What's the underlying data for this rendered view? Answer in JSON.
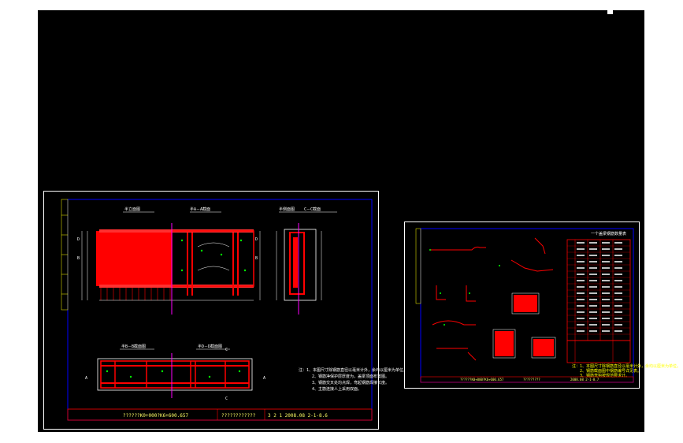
{
  "sheet1": {
    "views": {
      "elevation_title": "半立面图",
      "section_aa_title": "半A－A截面",
      "side_title": "半侧面图",
      "section_cc_title": "C－C截面",
      "section_bb_title": "半B－B截面图",
      "section_dd_title": "半D－D截面图"
    },
    "section_markers": [
      "A",
      "A",
      "B",
      "B",
      "C",
      "C",
      "D",
      "D"
    ],
    "notes": [
      "注：1、本图尺寸除钢筋直径以毫米计外，余均以厘米为单位。",
      "2、钢筋净保护层厚度为，盖梁顶面布置图。",
      "3、钢筋交叉处均点焊，弯起钢筋焊接长度。",
      "4、主筋连接人上采用双面。"
    ],
    "title_block": {
      "project": "??????K0+000?K6+600.657",
      "drawing": "????????????",
      "sheet_no": "3 2 1 2008.08 2-1-8.6"
    }
  },
  "sheet2": {
    "table_title": "一个盖梁钢筋数量表",
    "notes": [
      "注：1、本图尺寸除钢筋直径以毫米计外，余均以厘米为单位。",
      "2、钢筋截面图中钢筋编号详见表。",
      "3、钢筋弯钩按规范要求计。"
    ],
    "title_block": {
      "project": "??????K0+000?K6+600.657",
      "drawing": "?????????",
      "sheet_no": "2008.08 2-1-8.7"
    }
  },
  "colors": {
    "background": "#000000",
    "frame": "#0000ff",
    "rebar": "#ff0000",
    "text": "#ffff00",
    "axis": "#ff00ff",
    "lines": "#ffffff"
  }
}
